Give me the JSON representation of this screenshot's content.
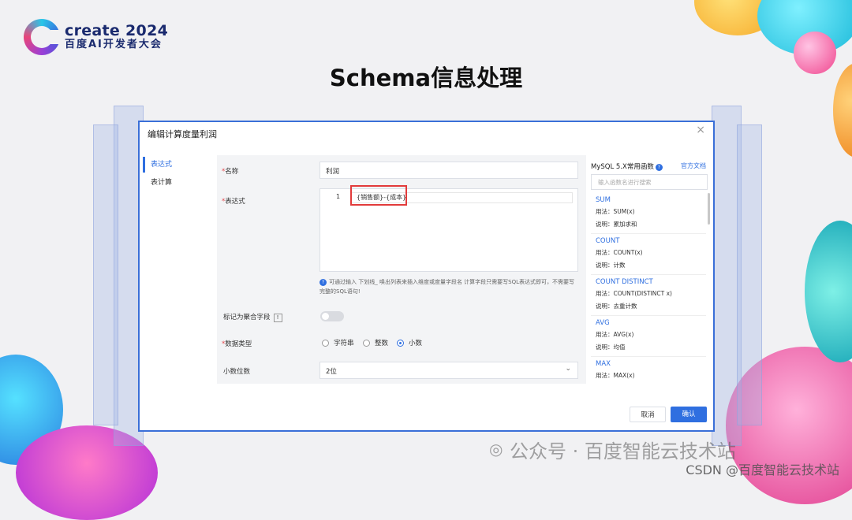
{
  "brand": {
    "title": "create 2024",
    "subtitle": "百度AI开发者大会"
  },
  "page_title": "Schema信息处理",
  "dialog": {
    "title": "编辑计算度量利润",
    "close": "×",
    "sidebar": [
      "表达式",
      "表计算"
    ],
    "form": {
      "name_label": "名称",
      "name_value": "利润",
      "expr_label": "表达式",
      "expr_line_number": "1",
      "expr_value": "{销售额}-{成本}",
      "hint_icon": "?",
      "hint": "可通过输入 下划线_ 唤出列表来插入维度或度量字段名 计算字段只需要写SQL表达式即可，不需要写完整的SQL语句!",
      "aggregate_label": "标记为聚合字段",
      "aggregate_icon": "!",
      "aggregate_on": false,
      "type_label": "数据类型",
      "type_options": [
        "字符串",
        "整数",
        "小数"
      ],
      "type_selected": "小数",
      "decimal_label": "小数位数",
      "decimal_value": "2位"
    },
    "functions": {
      "title": "MySQL 5.X常用函数",
      "help_icon": "?",
      "doc_link": "官方文档",
      "search_placeholder": "输入函数名进行搜索",
      "usage_prefix": "用法：",
      "desc_prefix": "说明：",
      "items": [
        {
          "name": "SUM",
          "usage": "SUM(x)",
          "desc": "累加求和"
        },
        {
          "name": "COUNT",
          "usage": "COUNT(x)",
          "desc": "计数"
        },
        {
          "name": "COUNT DISTINCT",
          "usage": "COUNT(DISTINCT x)",
          "desc": "去重计数"
        },
        {
          "name": "AVG",
          "usage": "AVG(x)",
          "desc": "均值"
        },
        {
          "name": "MAX",
          "usage": "MAX(x)",
          "desc": ""
        }
      ]
    },
    "buttons": {
      "cancel": "取消",
      "ok": "确认"
    }
  },
  "watermarks": {
    "wechat": "公众号 · 百度智能云技术站",
    "csdn": "CSDN @百度智能云技术站"
  },
  "colors": {
    "accent": "#2f6fe0",
    "highlight": "#e23b3b"
  }
}
